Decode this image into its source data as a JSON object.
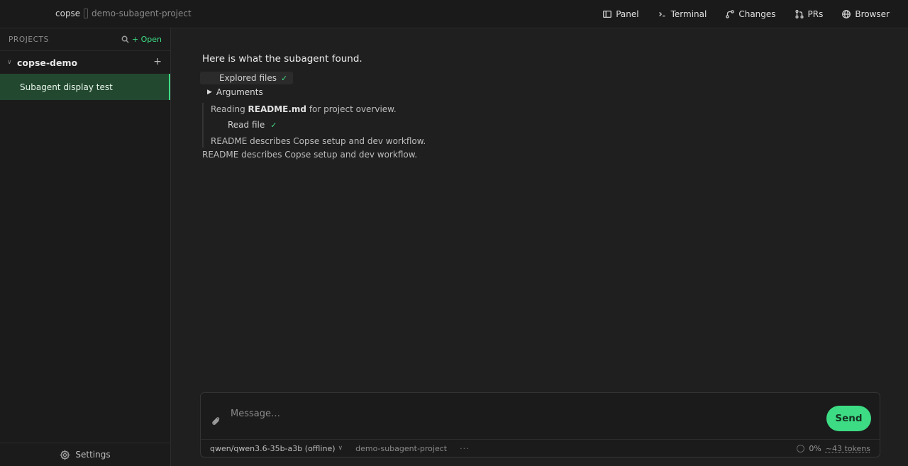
{
  "topbar": {
    "brand": "copse",
    "project": "demo-subagent-project",
    "actions": [
      {
        "label": "Panel",
        "icon": "panel-icon"
      },
      {
        "label": "Terminal",
        "icon": "terminal-icon"
      },
      {
        "label": "Changes",
        "icon": "changes-icon"
      },
      {
        "label": "PRs",
        "icon": "pull-request-icon"
      },
      {
        "label": "Browser",
        "icon": "globe-icon"
      }
    ]
  },
  "sidebar": {
    "title": "PROJECTS",
    "open_label": "+ Open",
    "project": {
      "name": "copse-demo",
      "add": "+"
    },
    "sessions": [
      {
        "label": "Subagent display test"
      }
    ],
    "settings_label": "Settings"
  },
  "conversation": {
    "title": "Here is what the subagent found.",
    "tool": {
      "label": "Explored files",
      "check": "✓"
    },
    "arguments_label": "Arguments",
    "nested": {
      "line1_prefix": "Reading ",
      "line1_file": "README.md",
      "line1_suffix": " for project overview.",
      "tool_label": "Read file",
      "check": "✓",
      "line2": "README describes Copse setup and dev workflow."
    },
    "summary": "README describes Copse setup and dev workflow."
  },
  "composer": {
    "placeholder": "Message…",
    "send_label": "Send",
    "model": "qwen/qwen3.6-35b-a3b (offline)",
    "cwd": "demo-subagent-project",
    "more": "···",
    "usage_percent": "0%",
    "tokens": "~43 tokens"
  }
}
